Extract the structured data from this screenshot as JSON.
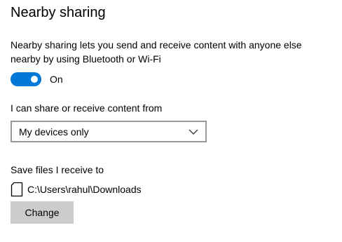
{
  "section": {
    "title": "Nearby sharing",
    "description": "Nearby sharing lets you send and receive content with anyone else nearby by using Bluetooth or Wi-Fi"
  },
  "toggle": {
    "state_label": "On",
    "is_on": true,
    "accent_color": "#0078d7"
  },
  "share_from": {
    "label": "I can share or receive content from",
    "selected": "My devices only",
    "icon": "chevron-down-icon"
  },
  "save_location": {
    "label": "Save files I receive to",
    "path": "C:\\Users\\rahul\\Downloads",
    "icon": "drive-icon",
    "button_label": "Change"
  }
}
